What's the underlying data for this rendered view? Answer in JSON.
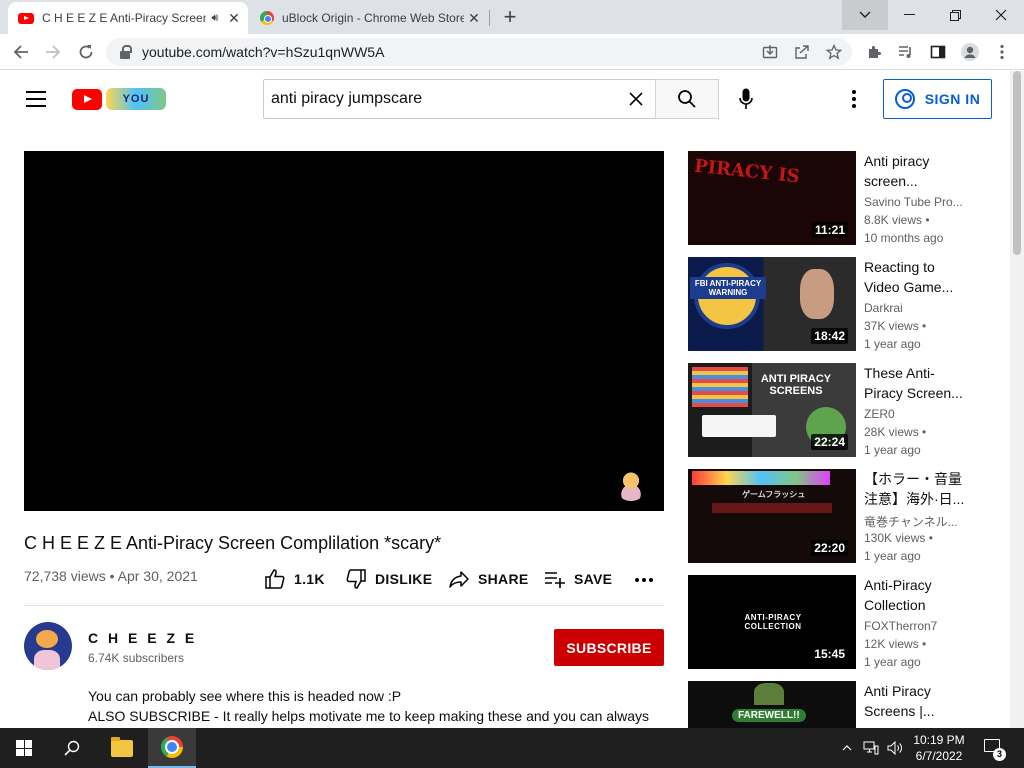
{
  "browser": {
    "tabs": [
      {
        "title": "C H E E Z E Anti-Piracy Screen Complilation *scary* - YouTube",
        "active": true
      },
      {
        "title": "uBlock Origin - Chrome Web Store",
        "active": false
      }
    ],
    "new_tab_label": "+",
    "url": "youtube.com/watch?v=hSzu1qnWW5A"
  },
  "youtube": {
    "search_query": "anti piracy jumpscare",
    "sign_in_label": "SIGN IN",
    "logo_doodle_text": "YOU",
    "video": {
      "title": "C H E E Z E Anti-Piracy Screen Complilation *scary*",
      "meta": "72,738 views • Apr 30, 2021",
      "likes": "1.1K",
      "dislike_label": "DISLIKE",
      "share_label": "SHARE",
      "save_label": "SAVE"
    },
    "channel": {
      "name": "C H E E Z E",
      "subscribers": "6.74K subscribers",
      "subscribe_label": "SUBSCRIBE"
    },
    "description": [
      "You can probably see where this is headed now :P",
      "ALSO SUBSCRIBE - It really helps motivate me to keep making these and you can always"
    ],
    "recommendations": [
      {
        "title": "Anti piracy screen...",
        "channel": "Savino Tube Pro...",
        "views": "8.8K views •",
        "age": "10 months ago",
        "duration": "11:21",
        "thumb_text": "PIRACY IS"
      },
      {
        "title": "Reacting to Video Game...",
        "channel": "Darkrai",
        "views": "37K views •",
        "age": "1 year ago",
        "duration": "18:42",
        "thumb_text": "FBI ANTI-PIRACY WARNING"
      },
      {
        "title": "These Anti-Piracy Screen...",
        "channel": "ZER0",
        "views": "28K views •",
        "age": "1 year ago",
        "duration": "22:24",
        "thumb_text": "ANTI PIRACY SCREENS"
      },
      {
        "title": "【ホラー・音量注意】海外·日...",
        "channel": "竜巻チャンネル...",
        "views": "130K views •",
        "age": "1 year ago",
        "duration": "22:20",
        "thumb_text": "ゲームフラッシュ"
      },
      {
        "title": "Anti-Piracy Collection",
        "channel": "FOXTherron7",
        "views": "12K views •",
        "age": "1 year ago",
        "duration": "15:45",
        "thumb_text": "ANTI-PIRACY COLLECTION"
      },
      {
        "title": "Anti Piracy Screens |...",
        "channel": "",
        "views": "",
        "age": "",
        "duration": "",
        "thumb_text": "FAREWELL!!"
      }
    ]
  },
  "taskbar": {
    "time": "10:19 PM",
    "date": "6/7/2022",
    "notification_count": "3"
  },
  "colors": {
    "youtube_red": "#ff0000",
    "subscribe_red": "#cc0000",
    "link_blue": "#065fd4",
    "taskbar": "#1f1f1f"
  }
}
